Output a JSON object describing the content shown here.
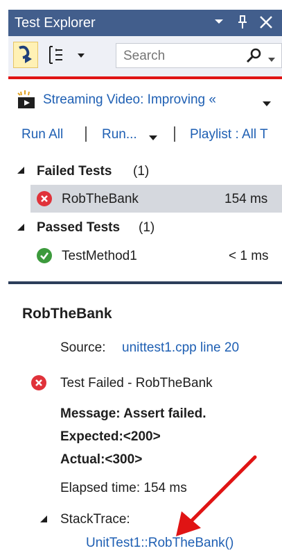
{
  "window": {
    "title": "Test Explorer"
  },
  "toolbar": {
    "search_placeholder": "Search"
  },
  "playlist": {
    "video_title": "Streaming Video: Improving «",
    "run_all": "Run All",
    "run_menu": "Run...",
    "playlist_label": "Playlist : All T"
  },
  "groups": [
    {
      "label": "Failed Tests",
      "count": "(1)",
      "tests": [
        {
          "name": "RobTheBank",
          "duration": "154 ms",
          "status": "failed"
        }
      ]
    },
    {
      "label": "Passed Tests",
      "count": "(1)",
      "tests": [
        {
          "name": "TestMethod1",
          "duration": "< 1 ms",
          "status": "passed"
        }
      ]
    }
  ],
  "detail": {
    "title": "RobTheBank",
    "source_label": "Source:",
    "source_link": "unittest1.cpp line 20",
    "status_text": "Test Failed - RobTheBank",
    "message_line1": "Message: Assert failed.",
    "message_line2": "Expected:<200>",
    "message_line3": "Actual:<300>",
    "elapsed": "Elapsed time: 154 ms",
    "stacktrace_label": "StackTrace:",
    "stack_frame": "UnitTest1::RobTheBank()"
  },
  "colors": {
    "titlebar": "#425e8c",
    "link": "#1e5fb3",
    "failed": "#e0323a",
    "passed": "#3c9a3c",
    "annotation_arrow": "#e01414"
  }
}
